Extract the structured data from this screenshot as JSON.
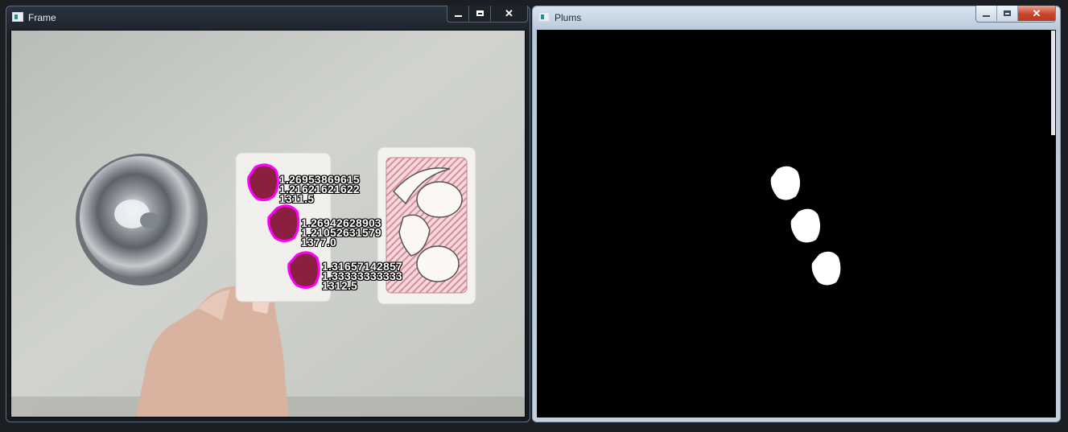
{
  "windows": {
    "frame": {
      "title": "Frame",
      "controls": {
        "minimize": "minimize-icon",
        "maximize": "maximize-icon",
        "close": "close-icon"
      },
      "detections": [
        {
          "lines": [
            "1.26953869615",
            "1.21621621622",
            "1311.5"
          ]
        },
        {
          "lines": [
            "1.26942628903",
            "1.21052631579",
            "1377.0"
          ]
        },
        {
          "lines": [
            "1.31657142857",
            "1.33333333333",
            "1312.5"
          ]
        }
      ],
      "colors": {
        "contour": "#ff00ff",
        "blob": "#8b1f3f"
      }
    },
    "plums": {
      "title": "Plums",
      "controls": {
        "minimize": "minimize-icon",
        "maximize": "maximize-icon",
        "close": "close-icon"
      },
      "colors": {
        "background": "#000000",
        "mask": "#ffffff"
      }
    }
  }
}
